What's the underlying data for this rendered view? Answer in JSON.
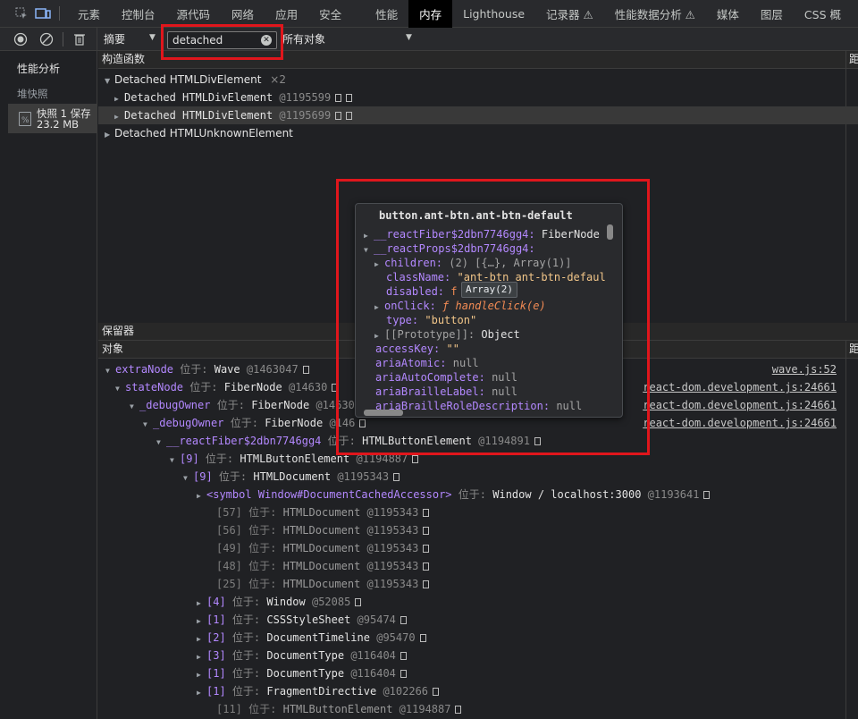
{
  "tabs": [
    "元素",
    "控制台",
    "源代码",
    "网络",
    "应用",
    "安全",
    "性能",
    "内存",
    "Lighthouse",
    "记录器 ⚠",
    "性能数据分析 ⚠",
    "媒体",
    "图层",
    "CSS 概"
  ],
  "selected_tab": "内存",
  "toolbar": {
    "view_select": "摘要",
    "filter_value": "detached",
    "object_scope": "所有对象"
  },
  "sidebar": {
    "profiles_heading": "性能分析",
    "heap_heading": "堆快照",
    "snapshot_name": "快照 1 保存",
    "snapshot_size": "23.2 MB"
  },
  "constructors": {
    "header": "构造函数",
    "right_header": "距",
    "rows": [
      {
        "name": "Detached HTMLDivElement",
        "count": "×2"
      },
      {
        "name": "Detached HTMLDivElement",
        "id": "@1195599"
      },
      {
        "name": "Detached HTMLDivElement",
        "id": "@1195699"
      },
      {
        "name": "Detached HTMLUnknownElement"
      }
    ]
  },
  "retainers": {
    "header": "保留器",
    "col_header": "对象",
    "right_header": "距",
    "rows": [
      {
        "key": "extraNode",
        "in": "位于:",
        "obj": "Wave",
        "id": "@1463047",
        "link": "wave.js:52"
      },
      {
        "key": "stateNode",
        "in": "位于:",
        "obj": "FiberNode",
        "id": "@14630",
        "link": "react-dom.development.js:24661"
      },
      {
        "key": "_debugOwner",
        "in": "位于:",
        "obj": "FiberNode",
        "id": "@14630",
        "link": "react-dom.development.js:24661"
      },
      {
        "key": "_debugOwner",
        "in": "位于:",
        "obj": "FiberNode",
        "id": "@146",
        "link": "react-dom.development.js:24661"
      },
      {
        "key": "__reactFiber$2dbn7746gg4",
        "in": "位于:",
        "obj": "HTMLButtonElement",
        "id": "@1194891"
      },
      {
        "key": "[9]",
        "in": "位于:",
        "obj": "HTMLButtonElement",
        "id": "@1194887"
      },
      {
        "key": "[9]",
        "in": "位于:",
        "obj": "HTMLDocument",
        "id": "@1195343"
      },
      {
        "key": "<symbol Window#DocumentCachedAccessor>",
        "in": "位于:",
        "obj": "Window / localhost:3000",
        "id": "@1193641"
      },
      {
        "key": "[57]",
        "in": "位于:",
        "obj": "HTMLDocument",
        "id": "@1195343"
      },
      {
        "key": "[56]",
        "in": "位于:",
        "obj": "HTMLDocument",
        "id": "@1195343"
      },
      {
        "key": "[49]",
        "in": "位于:",
        "obj": "HTMLDocument",
        "id": "@1195343"
      },
      {
        "key": "[48]",
        "in": "位于:",
        "obj": "HTMLDocument",
        "id": "@1195343"
      },
      {
        "key": "[25]",
        "in": "位于:",
        "obj": "HTMLDocument",
        "id": "@1195343"
      },
      {
        "key": "[4]",
        "in": "位于:",
        "obj": "Window",
        "id": "@52085"
      },
      {
        "key": "[1]",
        "in": "位于:",
        "obj": "CSSStyleSheet",
        "id": "@95474"
      },
      {
        "key": "[2]",
        "in": "位于:",
        "obj": "DocumentTimeline",
        "id": "@95470"
      },
      {
        "key": "[3]",
        "in": "位于:",
        "obj": "DocumentType",
        "id": "@116404"
      },
      {
        "key": "[1]",
        "in": "位于:",
        "obj": "DocumentType",
        "id": "@116404"
      },
      {
        "key": "[1]",
        "in": "位于:",
        "obj": "FragmentDirective",
        "id": "@102266"
      },
      {
        "key": "[11]",
        "in": "位于:",
        "obj": "HTMLButtonElement",
        "id": "@1194887"
      }
    ]
  },
  "popup": {
    "title": "button.ant-btn.ant-btn-default",
    "lines": [
      {
        "k": "__reactFiber$2dbn7746gg4",
        "v": "FiberNode"
      },
      {
        "k": "__reactProps$2dbn7746gg4",
        "v": ""
      },
      {
        "k": "children",
        "v": "(2) [{…}, Array(1)]"
      },
      {
        "k": "className",
        "v": "\"ant-btn ant-btn-defaul"
      },
      {
        "k": "disabled",
        "v": "f"
      },
      {
        "k": "onClick",
        "v": "ƒ handleClick(e)"
      },
      {
        "k": "type",
        "v": "\"button\""
      },
      {
        "k": "[[Prototype]]",
        "v": "Object"
      },
      {
        "k": "accessKey",
        "v": "\"\""
      },
      {
        "k": "ariaAtomic",
        "v": "null"
      },
      {
        "k": "ariaAutoComplete",
        "v": "null"
      },
      {
        "k": "ariaBrailleLabel",
        "v": "null"
      },
      {
        "k": "ariaBrailleRoleDescription",
        "v": "null"
      }
    ],
    "tooltip": "Array(2)"
  }
}
